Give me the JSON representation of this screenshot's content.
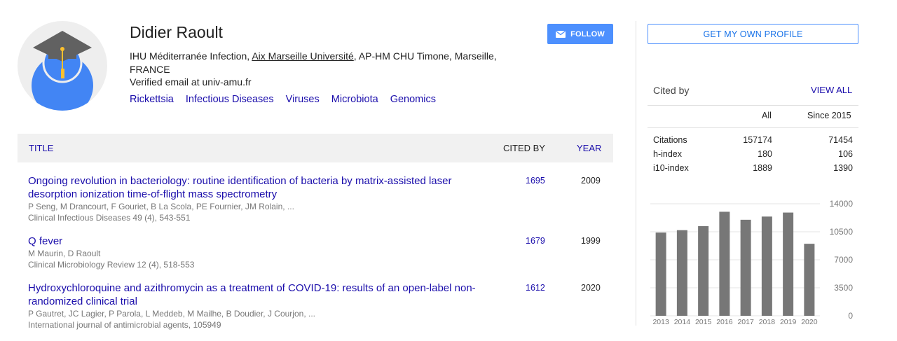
{
  "profile": {
    "name": "Didier Raoult",
    "affiliation_before": "IHU Méditerranée Infection, ",
    "affiliation_link": "Aix Marseille Université",
    "affiliation_after": ", AP-HM CHU Timone, Marseille, FRANCE",
    "email": "Verified email at univ-amu.fr",
    "interests": [
      "Rickettsia",
      "Infectious Diseases",
      "Viruses",
      "Microbiota",
      "Genomics"
    ]
  },
  "buttons": {
    "follow": "FOLLOW",
    "get_profile": "GET MY OWN PROFILE"
  },
  "table": {
    "col_title": "TITLE",
    "col_cited": "CITED BY",
    "col_year": "YEAR",
    "rows": [
      {
        "title": "Ongoing revolution in bacteriology: routine identification of bacteria by matrix-assisted laser desorption ionization time-of-flight mass spectrometry",
        "authors": "P Seng, M Drancourt, F Gouriet, B La Scola, PE Fournier, JM Rolain, ...",
        "venue": "Clinical Infectious Diseases 49 (4), 543-551",
        "cites": "1695",
        "year": "2009"
      },
      {
        "title": "Q fever",
        "authors": "M Maurin, D Raoult",
        "venue": "Clinical Microbiology Review 12 (4), 518-553",
        "cites": "1679",
        "year": "1999"
      },
      {
        "title": "Hydroxychloroquine and azithromycin as a treatment of COVID-19: results of an open-label non-randomized clinical trial",
        "authors": "P Gautret, JC Lagier, P Parola, L Meddeb, M Mailhe, B Doudier, J Courjon, ...",
        "venue": "International journal of antimicrobial agents, 105949",
        "cites": "1612",
        "year": "2020"
      }
    ]
  },
  "cited_by": {
    "heading": "Cited by",
    "view_all": "VIEW ALL",
    "col_all": "All",
    "col_since": "Since 2015",
    "stats": [
      {
        "label": "Citations",
        "all": "157174",
        "since": "71454"
      },
      {
        "label": "h-index",
        "all": "180",
        "since": "106"
      },
      {
        "label": "i10-index",
        "all": "1889",
        "since": "1390"
      }
    ]
  },
  "icons": {
    "follow": "envelope-icon",
    "avatar": "graduate-avatar-icon"
  },
  "colors": {
    "link": "#1a0dab",
    "accent": "#4d90fe",
    "bar": "#777777"
  },
  "chart_data": {
    "type": "bar",
    "categories": [
      "2013",
      "2014",
      "2015",
      "2016",
      "2017",
      "2018",
      "2019",
      "2020"
    ],
    "values": [
      10400,
      10700,
      11200,
      13000,
      12000,
      12400,
      12900,
      9000
    ],
    "yticks": [
      "14000",
      "10500",
      "7000",
      "3500",
      "0"
    ],
    "ylim": [
      0,
      14000
    ],
    "grid": true
  }
}
